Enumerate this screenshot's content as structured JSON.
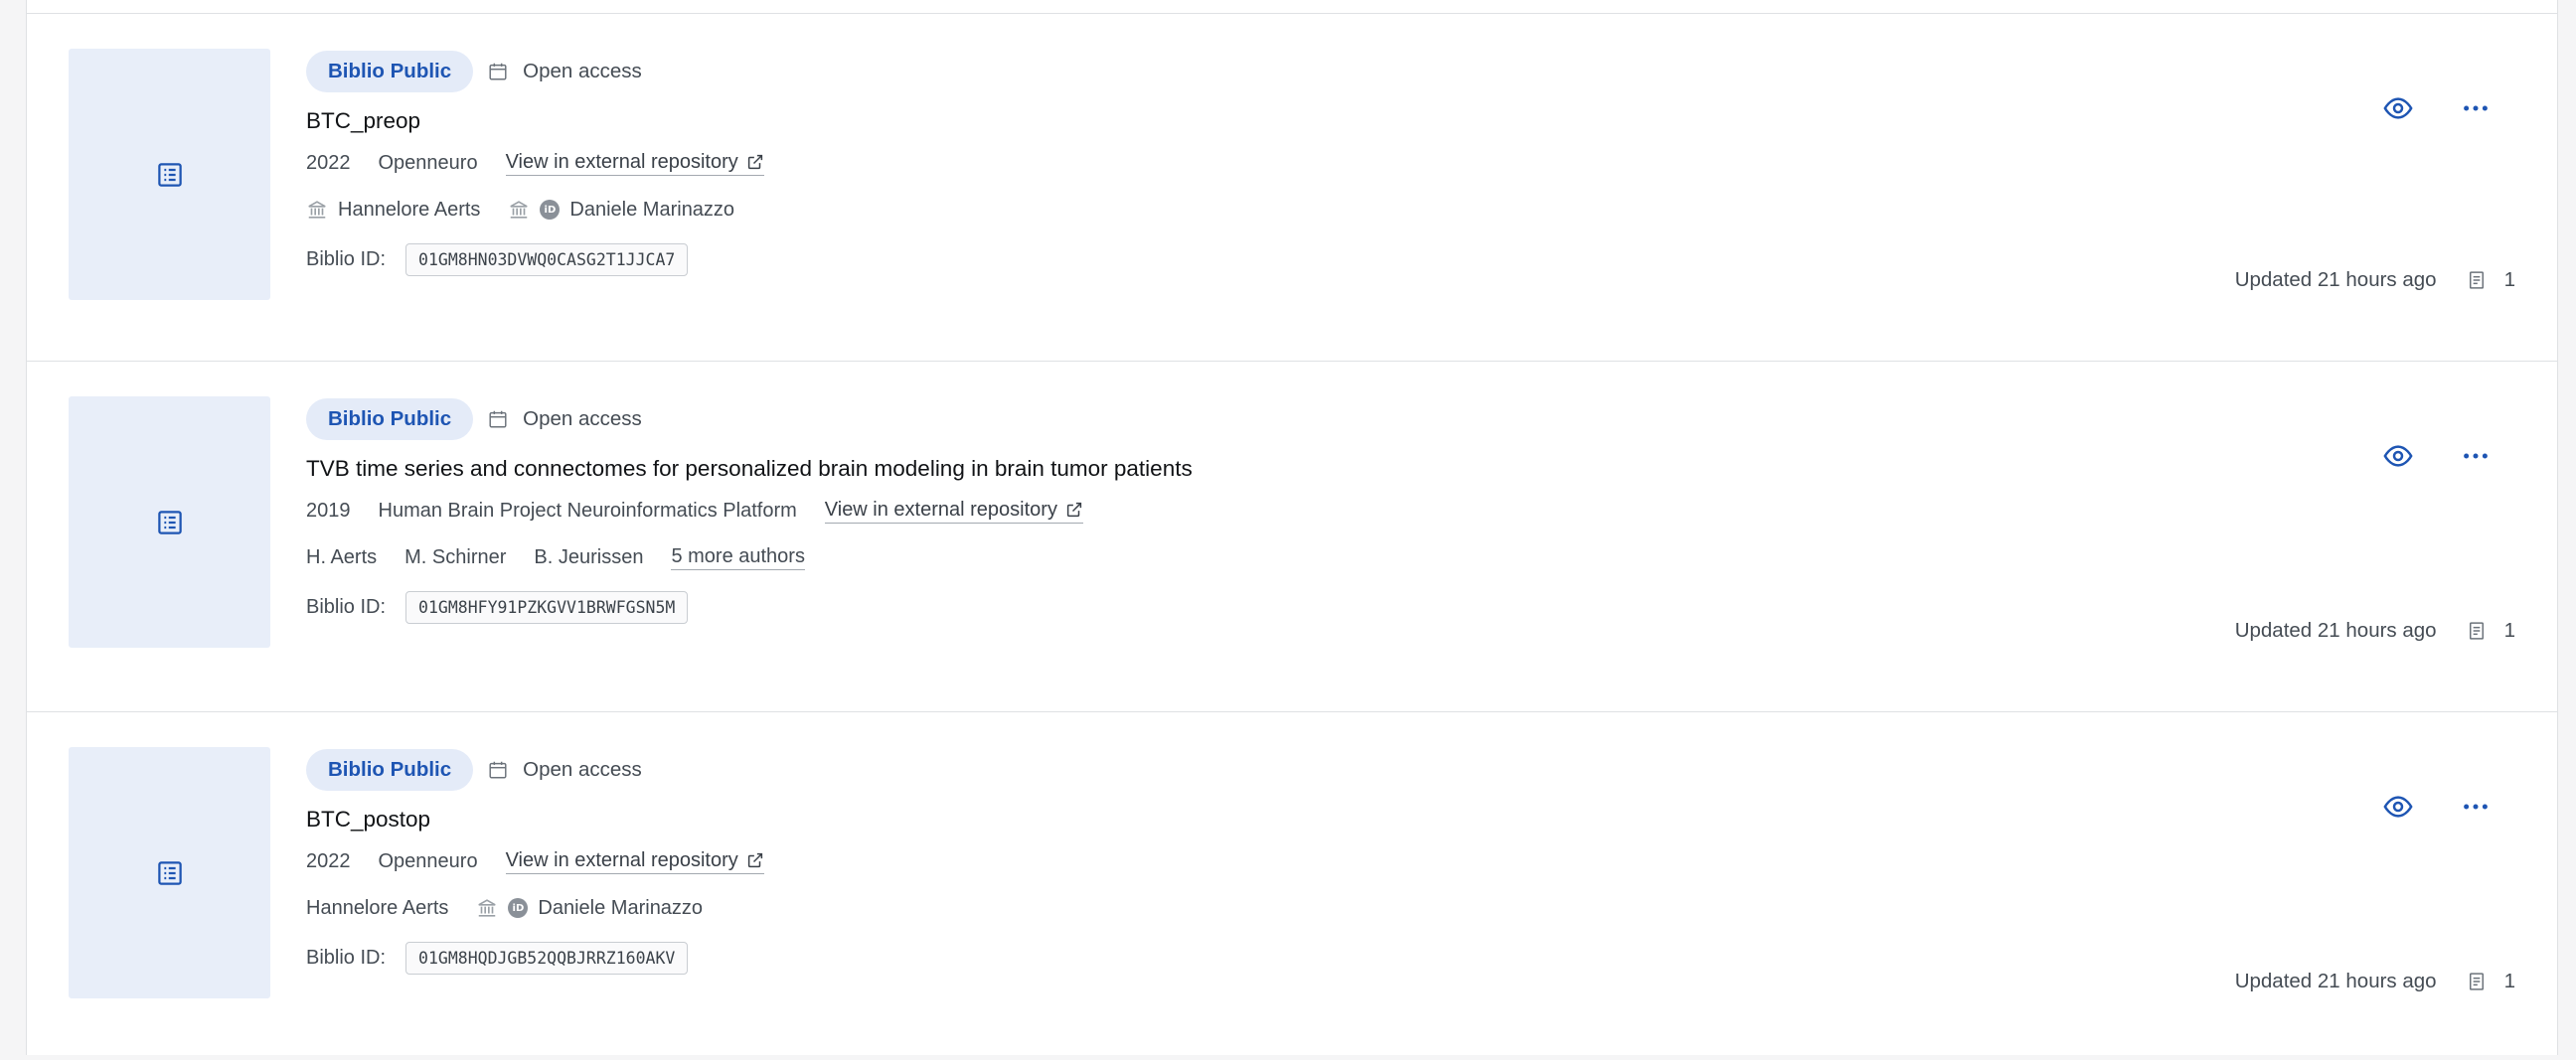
{
  "colors": {
    "accent": "#1e55b3",
    "badge_bg": "#e4ebf8",
    "thumb_bg": "#e8eef9",
    "border": "#dfe1e4"
  },
  "icons": {
    "thumbnail": "document-list-icon",
    "access": "calendar-icon",
    "external": "external-link-icon",
    "view": "eye-icon",
    "more": "ellipsis-icon",
    "institution": "institution-icon",
    "orcid": "orcid-icon",
    "files": "file-icon"
  },
  "items": [
    {
      "badge": "Biblio Public",
      "access": "Open access",
      "title": "BTC_preop",
      "year": "2022",
      "publisher": "Openneuro",
      "external_link": "View in external repository",
      "authors": [
        {
          "name": "Hannelore Aerts",
          "institution_icon": true,
          "orcid": false
        },
        {
          "name": "Daniele Marinazzo",
          "institution_icon": true,
          "orcid": true
        }
      ],
      "more_authors": "",
      "id_label": "Biblio ID:",
      "biblio_id": "01GM8HN03DVWQ0CASG2T1JJCA7",
      "updated": "Updated 21 hours ago",
      "file_count": "1"
    },
    {
      "badge": "Biblio Public",
      "access": "Open access",
      "title": "TVB time series and connectomes for personalized brain modeling in brain tumor patients",
      "year": "2019",
      "publisher": "Human Brain Project Neuroinformatics Platform",
      "external_link": "View in external repository",
      "authors": [
        {
          "name": "H. Aerts",
          "institution_icon": false,
          "orcid": false
        },
        {
          "name": "M. Schirner",
          "institution_icon": false,
          "orcid": false
        },
        {
          "name": "B. Jeurissen",
          "institution_icon": false,
          "orcid": false
        }
      ],
      "more_authors": "5 more authors",
      "id_label": "Biblio ID:",
      "biblio_id": "01GM8HFY91PZKGVV1BRWFGSN5M",
      "updated": "Updated 21 hours ago",
      "file_count": "1"
    },
    {
      "badge": "Biblio Public",
      "access": "Open access",
      "title": "BTC_postop",
      "year": "2022",
      "publisher": "Openneuro",
      "external_link": "View in external repository",
      "authors": [
        {
          "name": "Hannelore Aerts",
          "institution_icon": false,
          "orcid": false
        },
        {
          "name": "Daniele Marinazzo",
          "institution_icon": true,
          "orcid": true
        }
      ],
      "more_authors": "",
      "id_label": "Biblio ID:",
      "biblio_id": "01GM8HQDJGB52QQBJRRZ160AKV",
      "updated": "Updated 21 hours ago",
      "file_count": "1"
    }
  ]
}
